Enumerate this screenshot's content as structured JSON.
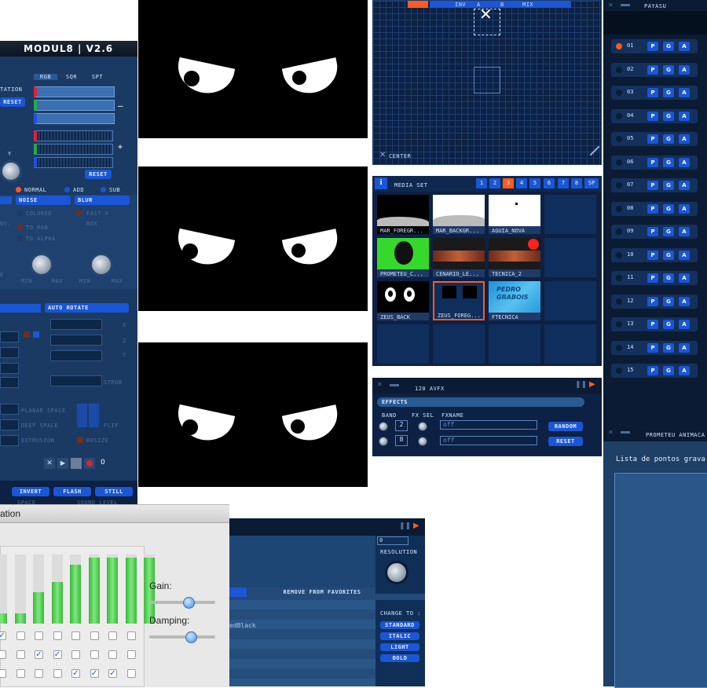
{
  "modul8": {
    "title": "MODUL8 | V2.6",
    "tabs": [
      "RGB",
      "SQR",
      "SPT"
    ],
    "rotation_label": "TATION",
    "reset_left": "RESET",
    "reset_right": "RESET",
    "y_label": "Y",
    "minus": "–",
    "plus": "+",
    "blend_modes": [
      "NORMAL",
      "ADD",
      "SUB"
    ],
    "noise_label": "NOISE",
    "blur_label": "BLUR",
    "colored_label": "COLORED",
    "to_rgb_label": "TO RGB",
    "to_alpha_label": "TO ALPHA",
    "fast_x_label": "FAST X",
    "box_label": "BOX",
    "nv_label": "NV.",
    "e_label": "E",
    "min_label": "MIN",
    "max_label": "MAX",
    "auto_rotate_label": "AUTO ROTATE",
    "xyz": [
      "X",
      "Z",
      "Y"
    ],
    "strob_label": "STROB",
    "planar_space": "PLANAR SPACE",
    "deep_space": "DEEP SPACE",
    "extrusion": "EXTRUSION",
    "flip": "FLIP",
    "resize": "RESIZE",
    "record_count": "0",
    "bottom_buttons": [
      "INVERT",
      "FLASH",
      "STILL"
    ],
    "space_label": "SPACE",
    "sound_level_label": "SOUND LEVEL"
  },
  "grid": {
    "tabs": [
      "INV",
      "A",
      "B",
      "MIX"
    ],
    "center_label": "CENTER"
  },
  "media_set": {
    "title": "MEDIA SET",
    "info": "i",
    "tabs": [
      "1",
      "2",
      "3",
      "4",
      "5",
      "6",
      "7",
      "8",
      "SP"
    ],
    "thumbs": [
      "MAR_FOREGR...",
      "MAR_BACKGR...",
      "AGUIA_NOVA",
      "PROMETEU_C...",
      "CENARIO_LE...",
      "TECNICA_2",
      "ZEUS_BACK",
      "ZEUS_FOREG...",
      "FTECNICA"
    ],
    "pedro_text": "PEDRO GRABOIS"
  },
  "fx": {
    "title": "120 AVFX",
    "effects_label": "EFFECTS",
    "headers": [
      "BAND",
      "FX SEL",
      "FXNAME"
    ],
    "rows": [
      {
        "band": "2",
        "name": "off",
        "button": "RANDOM"
      },
      {
        "band": "8",
        "name": "off",
        "button": "RESET"
      }
    ]
  },
  "right_list": {
    "title": "PAYASU",
    "buttons": [
      "P",
      "G",
      "A"
    ],
    "rows": [
      "01",
      "02",
      "03",
      "04",
      "05",
      "06",
      "07",
      "08",
      "09",
      "10",
      "11",
      "12",
      "13",
      "14",
      "15"
    ]
  },
  "mac_window": {
    "title": "ation",
    "gain_label": "Gain:",
    "damping_label": "Damping:",
    "bar_levels": [
      0.15,
      0.15,
      0.45,
      0.6,
      0.85,
      0.95,
      0.95,
      0.95,
      0.95
    ],
    "checks": [
      [
        true,
        false,
        false,
        false,
        false,
        false,
        false,
        false
      ],
      [
        false,
        false,
        true,
        true,
        false,
        false,
        false,
        false
      ],
      [
        false,
        false,
        false,
        false,
        true,
        true,
        true,
        false
      ]
    ],
    "gain_value": 0.6,
    "damping_value": 0.65
  },
  "fonts_panel": {
    "resolution_label": "RESOLUTION",
    "value": "0",
    "remove_favorites": "REMOVE FROM FAVORITES",
    "font_name": "edBlack",
    "change_to": "CHANGE TO :",
    "styles": [
      "STANDARD",
      "ITALIC",
      "LIGHT",
      "BOLD"
    ]
  },
  "prometeu": {
    "title": "PROMETEU ANIMACA",
    "list_label": "Lista de pontos grava"
  },
  "colors": {
    "accent_blue": "#1a56d6",
    "accent_orange": "#ff5a1f",
    "panel_navy": "#0c2143"
  }
}
